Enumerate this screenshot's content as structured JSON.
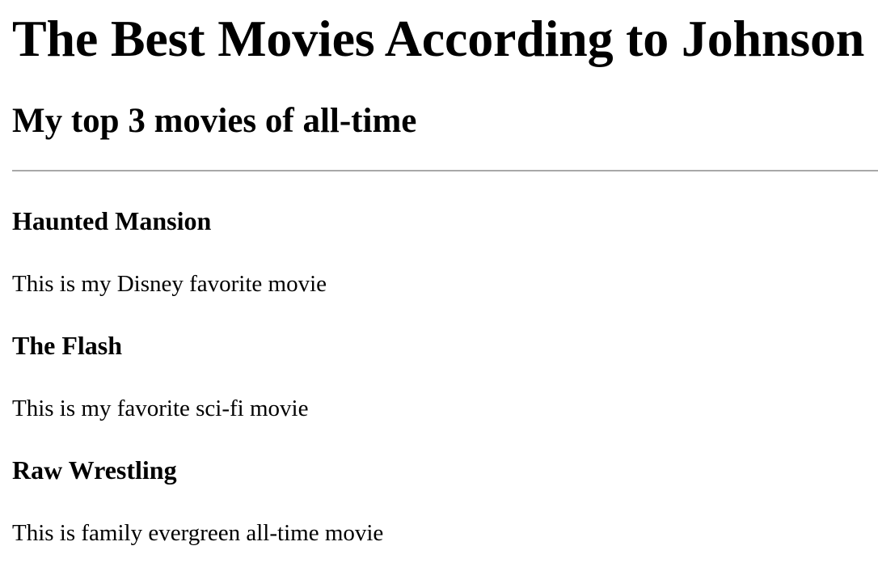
{
  "page": {
    "title": "The Best Movies According to Johnson",
    "subtitle": "My top 3 movies of all-time"
  },
  "movies": [
    {
      "title": "Haunted Mansion",
      "description": "This is my Disney favorite movie"
    },
    {
      "title": "The Flash",
      "description": "This is my favorite sci-fi movie"
    },
    {
      "title": "Raw Wrestling",
      "description": "This is family evergreen all-time movie"
    }
  ]
}
